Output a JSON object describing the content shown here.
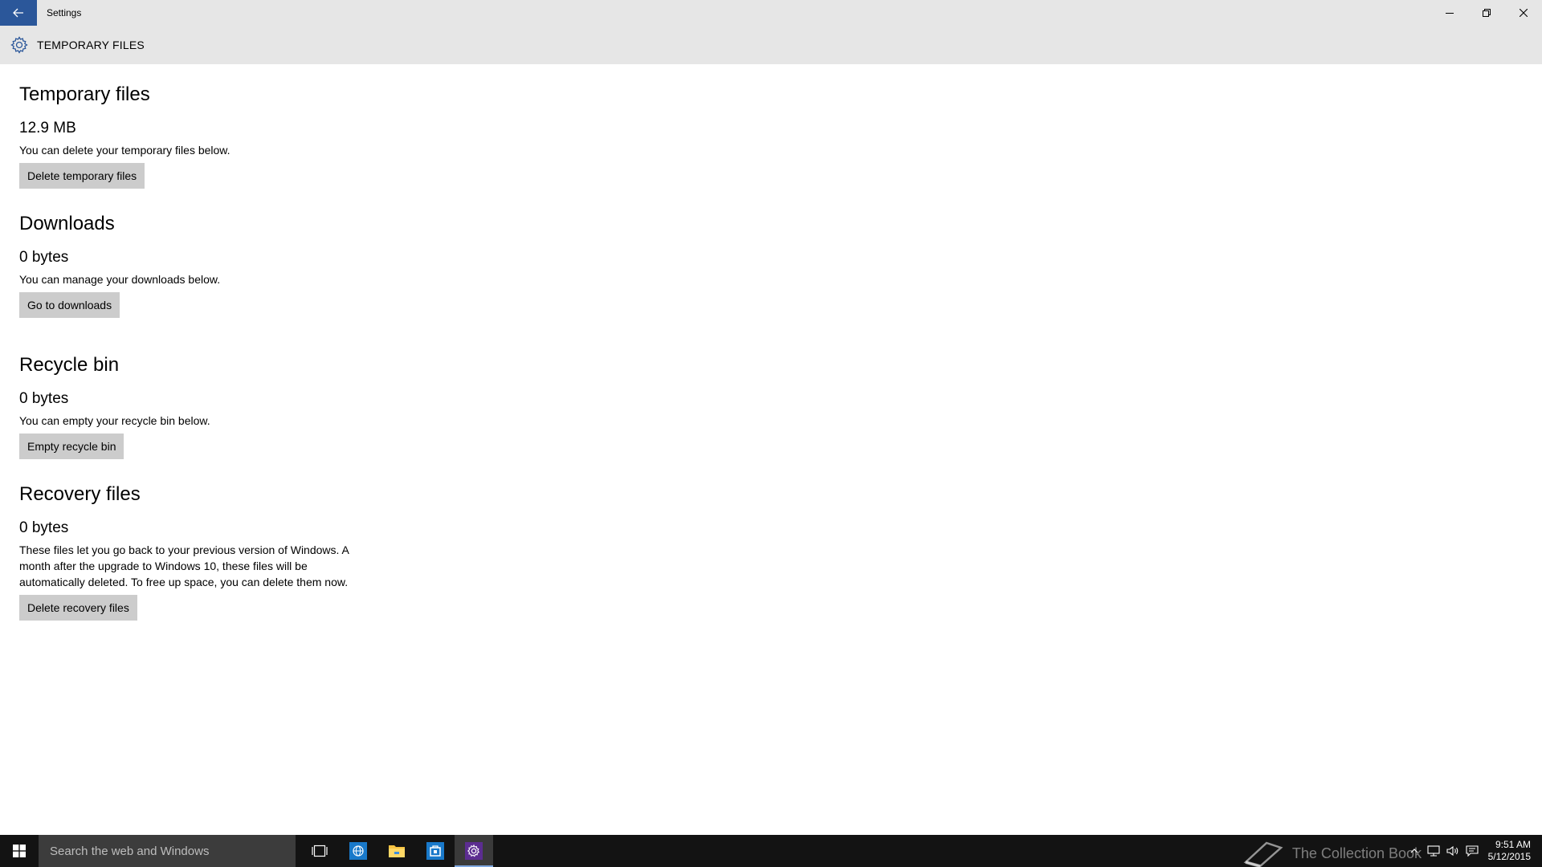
{
  "window": {
    "title": "Settings"
  },
  "header": {
    "title": "TEMPORARY FILES"
  },
  "sections": [
    {
      "title": "Temporary files",
      "size": "12.9 MB",
      "description": [
        "You can delete your temporary files below."
      ],
      "button": "Delete temporary files"
    },
    {
      "title": "Downloads",
      "size": "0 bytes",
      "description": [
        "You can manage your downloads below."
      ],
      "button": "Go to downloads"
    },
    {
      "title": "Recycle bin",
      "size": "0 bytes",
      "description": [
        "You can empty your recycle bin below."
      ],
      "button": "Empty recycle bin"
    },
    {
      "title": "Recovery files",
      "size": "0 bytes",
      "description": [
        "These files let you go back to your previous version of Windows. A",
        "month after the upgrade to Windows 10, these files will be",
        "automatically deleted. To free up space, you can delete them now."
      ],
      "button": "Delete recovery files"
    }
  ],
  "taskbar": {
    "search_placeholder": "Search the web and Windows",
    "watermark": "The Collection Book",
    "time": "9:51 AM",
    "date": "5/12/2015"
  },
  "colors": {
    "accent": "#2b579a",
    "button_bg": "#cccccc",
    "header_bg": "#e6e6e6",
    "taskbar_bg": "#131313"
  }
}
